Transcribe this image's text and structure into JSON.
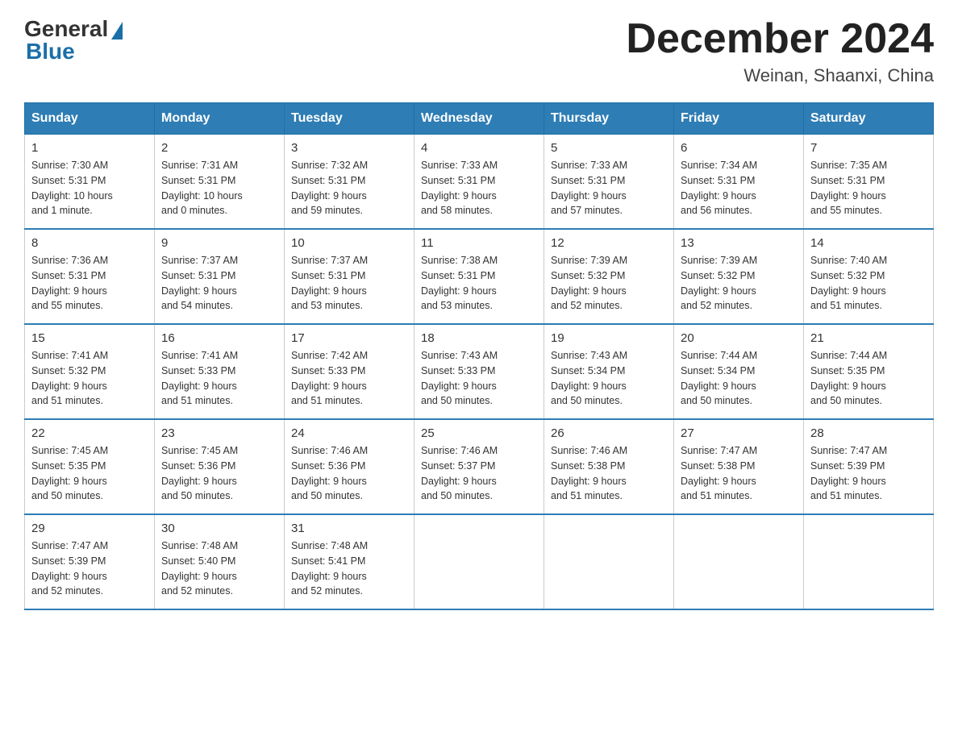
{
  "logo": {
    "general": "General",
    "blue": "Blue"
  },
  "title": "December 2024",
  "location": "Weinan, Shaanxi, China",
  "days_of_week": [
    "Sunday",
    "Monday",
    "Tuesday",
    "Wednesday",
    "Thursday",
    "Friday",
    "Saturday"
  ],
  "weeks": [
    [
      {
        "day": "1",
        "sunrise": "7:30 AM",
        "sunset": "5:31 PM",
        "daylight": "10 hours and 1 minute."
      },
      {
        "day": "2",
        "sunrise": "7:31 AM",
        "sunset": "5:31 PM",
        "daylight": "10 hours and 0 minutes."
      },
      {
        "day": "3",
        "sunrise": "7:32 AM",
        "sunset": "5:31 PM",
        "daylight": "9 hours and 59 minutes."
      },
      {
        "day": "4",
        "sunrise": "7:33 AM",
        "sunset": "5:31 PM",
        "daylight": "9 hours and 58 minutes."
      },
      {
        "day": "5",
        "sunrise": "7:33 AM",
        "sunset": "5:31 PM",
        "daylight": "9 hours and 57 minutes."
      },
      {
        "day": "6",
        "sunrise": "7:34 AM",
        "sunset": "5:31 PM",
        "daylight": "9 hours and 56 minutes."
      },
      {
        "day": "7",
        "sunrise": "7:35 AM",
        "sunset": "5:31 PM",
        "daylight": "9 hours and 55 minutes."
      }
    ],
    [
      {
        "day": "8",
        "sunrise": "7:36 AM",
        "sunset": "5:31 PM",
        "daylight": "9 hours and 55 minutes."
      },
      {
        "day": "9",
        "sunrise": "7:37 AM",
        "sunset": "5:31 PM",
        "daylight": "9 hours and 54 minutes."
      },
      {
        "day": "10",
        "sunrise": "7:37 AM",
        "sunset": "5:31 PM",
        "daylight": "9 hours and 53 minutes."
      },
      {
        "day": "11",
        "sunrise": "7:38 AM",
        "sunset": "5:31 PM",
        "daylight": "9 hours and 53 minutes."
      },
      {
        "day": "12",
        "sunrise": "7:39 AM",
        "sunset": "5:32 PM",
        "daylight": "9 hours and 52 minutes."
      },
      {
        "day": "13",
        "sunrise": "7:39 AM",
        "sunset": "5:32 PM",
        "daylight": "9 hours and 52 minutes."
      },
      {
        "day": "14",
        "sunrise": "7:40 AM",
        "sunset": "5:32 PM",
        "daylight": "9 hours and 51 minutes."
      }
    ],
    [
      {
        "day": "15",
        "sunrise": "7:41 AM",
        "sunset": "5:32 PM",
        "daylight": "9 hours and 51 minutes."
      },
      {
        "day": "16",
        "sunrise": "7:41 AM",
        "sunset": "5:33 PM",
        "daylight": "9 hours and 51 minutes."
      },
      {
        "day": "17",
        "sunrise": "7:42 AM",
        "sunset": "5:33 PM",
        "daylight": "9 hours and 51 minutes."
      },
      {
        "day": "18",
        "sunrise": "7:43 AM",
        "sunset": "5:33 PM",
        "daylight": "9 hours and 50 minutes."
      },
      {
        "day": "19",
        "sunrise": "7:43 AM",
        "sunset": "5:34 PM",
        "daylight": "9 hours and 50 minutes."
      },
      {
        "day": "20",
        "sunrise": "7:44 AM",
        "sunset": "5:34 PM",
        "daylight": "9 hours and 50 minutes."
      },
      {
        "day": "21",
        "sunrise": "7:44 AM",
        "sunset": "5:35 PM",
        "daylight": "9 hours and 50 minutes."
      }
    ],
    [
      {
        "day": "22",
        "sunrise": "7:45 AM",
        "sunset": "5:35 PM",
        "daylight": "9 hours and 50 minutes."
      },
      {
        "day": "23",
        "sunrise": "7:45 AM",
        "sunset": "5:36 PM",
        "daylight": "9 hours and 50 minutes."
      },
      {
        "day": "24",
        "sunrise": "7:46 AM",
        "sunset": "5:36 PM",
        "daylight": "9 hours and 50 minutes."
      },
      {
        "day": "25",
        "sunrise": "7:46 AM",
        "sunset": "5:37 PM",
        "daylight": "9 hours and 50 minutes."
      },
      {
        "day": "26",
        "sunrise": "7:46 AM",
        "sunset": "5:38 PM",
        "daylight": "9 hours and 51 minutes."
      },
      {
        "day": "27",
        "sunrise": "7:47 AM",
        "sunset": "5:38 PM",
        "daylight": "9 hours and 51 minutes."
      },
      {
        "day": "28",
        "sunrise": "7:47 AM",
        "sunset": "5:39 PM",
        "daylight": "9 hours and 51 minutes."
      }
    ],
    [
      {
        "day": "29",
        "sunrise": "7:47 AM",
        "sunset": "5:39 PM",
        "daylight": "9 hours and 52 minutes."
      },
      {
        "day": "30",
        "sunrise": "7:48 AM",
        "sunset": "5:40 PM",
        "daylight": "9 hours and 52 minutes."
      },
      {
        "day": "31",
        "sunrise": "7:48 AM",
        "sunset": "5:41 PM",
        "daylight": "9 hours and 52 minutes."
      },
      null,
      null,
      null,
      null
    ]
  ],
  "labels": {
    "sunrise": "Sunrise:",
    "sunset": "Sunset:",
    "daylight": "Daylight:"
  }
}
